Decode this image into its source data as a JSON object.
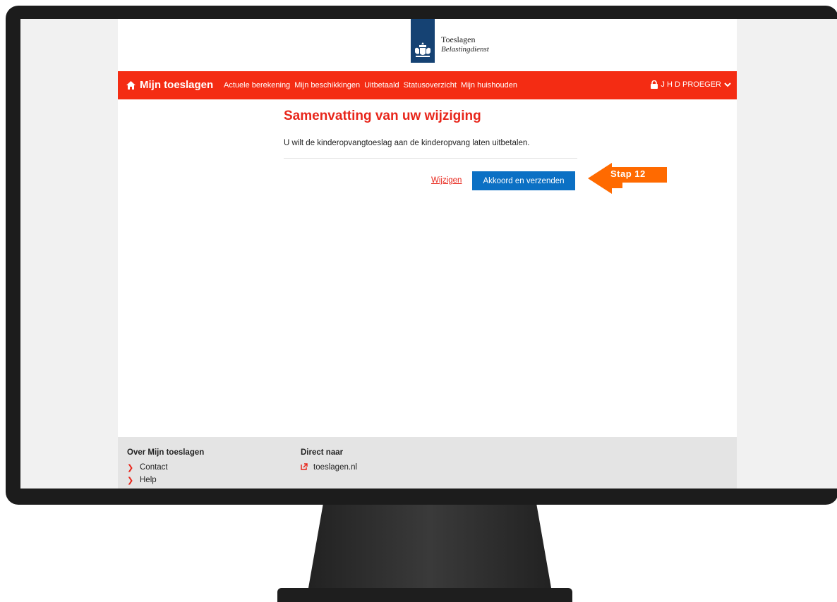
{
  "logo": {
    "title": "Toeslagen",
    "subtitle": "Belastingdienst",
    "emblem_color": "#154273"
  },
  "nav": {
    "home_label": "Mijn toeslagen",
    "links": [
      "Actuele berekening",
      "Mijn beschikkingen",
      "Uitbetaald",
      "Statusoverzicht",
      "Mijn huishouden"
    ],
    "user": "J H D PROEGER",
    "bar_color": "#f42c13"
  },
  "main": {
    "title": "Samenvatting van uw wijziging",
    "summary": "U wilt de kinderopvangtoeslag aan de kinderopvang laten uitbetalen.",
    "change_link": "Wijzigen",
    "submit_button": "Akkoord en verzenden",
    "button_color": "#0b70c4"
  },
  "footer": {
    "col1": {
      "heading": "Over Mijn toeslagen",
      "items": [
        "Contact",
        "Help"
      ]
    },
    "col2": {
      "heading": "Direct naar",
      "items": [
        "toeslagen.nl"
      ]
    }
  },
  "callout": {
    "label": "Stap 12",
    "color": "#ff6a00"
  }
}
